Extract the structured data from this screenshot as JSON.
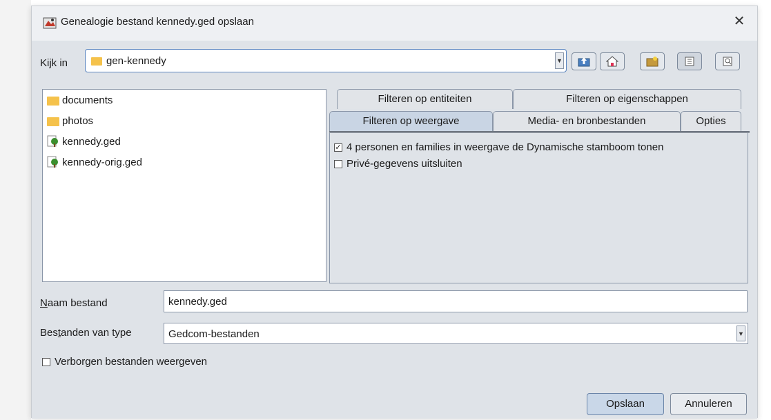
{
  "window": {
    "title": "Genealogie bestand kennedy.ged opslaan",
    "close_glyph": "✕"
  },
  "lookin": {
    "label": "Kijk in",
    "value": "gen-kennedy",
    "arrow": "▼"
  },
  "toolbar": {
    "icons": [
      "up-folder-icon",
      "home-icon",
      "new-folder-icon",
      "list-view-icon",
      "details-view-icon"
    ]
  },
  "files": [
    {
      "name": "documents",
      "type": "folder"
    },
    {
      "name": "photos",
      "type": "folder"
    },
    {
      "name": "kennedy.ged",
      "type": "gedcom"
    },
    {
      "name": "kennedy-orig.ged",
      "type": "gedcom"
    }
  ],
  "tabs": {
    "row1": [
      "Filteren op entiteiten",
      "Filteren op eigenschappen"
    ],
    "row2": [
      "Filteren op weergave",
      "Media- en bronbestanden",
      "Opties"
    ],
    "active": "Filteren op weergave"
  },
  "options": [
    {
      "label": "4 personen en families in weergave de Dynamische stamboom tonen",
      "checked": true
    },
    {
      "label": "Privé-gegevens uitsluiten",
      "checked": false
    }
  ],
  "filename": {
    "label_prefix": "N",
    "label_rest": "aam bestand",
    "value": "kennedy.ged"
  },
  "filetype": {
    "label_a": "Bes",
    "label_u": "t",
    "label_b": "anden van type",
    "value": "Gedcom-bestanden"
  },
  "hidden_files": {
    "label": "Verborgen bestanden weergeven",
    "checked": false
  },
  "buttons": {
    "save": "Opslaan",
    "cancel": "Annuleren"
  },
  "colors": {
    "folder": "#f5c24b",
    "active_tab": "#c9d5e4",
    "focus_border": "#5a85c0"
  }
}
